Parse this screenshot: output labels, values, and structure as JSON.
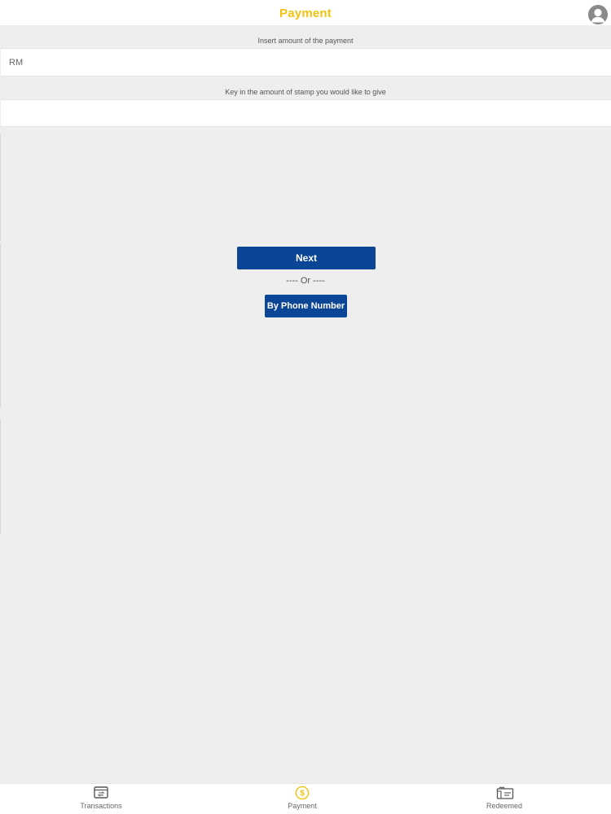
{
  "header": {
    "title": "Payment",
    "title_color": "#f2c20f",
    "avatar_icon": "user-avatar-icon"
  },
  "payment_amount": {
    "label": "Insert amount of the payment",
    "placeholder": "RM",
    "value": ""
  },
  "stamp_amount": {
    "label": "Key in the amount of stamp you would like to give",
    "placeholder": "",
    "value": ""
  },
  "actions": {
    "next_label": "Next",
    "or_label": "---- Or ----",
    "phone_label": "By Phone Number",
    "button_color": "#0b4596"
  },
  "tabbar": {
    "active": "Payment",
    "items": [
      {
        "label": "Transactions",
        "icon": "transactions-icon"
      },
      {
        "label": "Payment",
        "icon": "dollar-coin-icon",
        "color": "#f2c20f"
      },
      {
        "label": "Redeemed",
        "icon": "redeemed-ticket-icon"
      }
    ]
  }
}
